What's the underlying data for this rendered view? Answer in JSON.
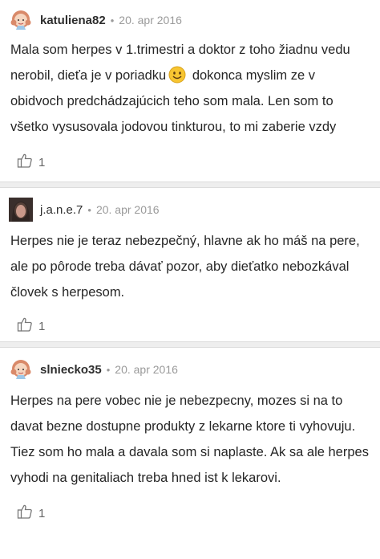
{
  "comments": [
    {
      "user": "katuliena82",
      "separator": "•",
      "date": "20. apr 2016",
      "avatar_icon": "girl-avatar-icon",
      "text_before_emoji": "Mala som herpes v 1.trimestri a doktor z toho žiadnu vedu nerobil, dieťa je v poriadku",
      "emoji": "smiley-emoji-icon",
      "text_after_emoji": "dokonca myslim ze v obidvoch predchádzajúcich teho som mala. Len som to všetko vysusovala jodovou tinkturou, to mi zaberie vzdy",
      "likes": "1"
    },
    {
      "user": "j.a.n.e.7",
      "separator": "•",
      "date": "20. apr 2016",
      "avatar_icon": "photo-avatar-icon",
      "text": "Herpes nie je teraz nebezpečný, hlavne ak ho máš na pere, ale po pôrode treba dávať pozor, aby dieťatko nebozkával človek s herpesom.",
      "likes": "1"
    },
    {
      "user": "slniecko35",
      "separator": "•",
      "date": "20. apr 2016",
      "avatar_icon": "girl-avatar-icon",
      "text": "Herpes na pere vobec nie je nebezpecny, mozes si na to davat bezne dostupne produkty z lekarne ktore ti vyhovuju. Tiez som ho mala a davala som si naplaste. Ak sa ale herpes vyhodi na genitaliach treba hned ist k lekarovi.",
      "likes": "1"
    }
  ],
  "like_icon": "thumbs-up-icon",
  "colors": {
    "text": "#262626",
    "meta": "#9a9a9a",
    "separator": "#eeeeee"
  }
}
